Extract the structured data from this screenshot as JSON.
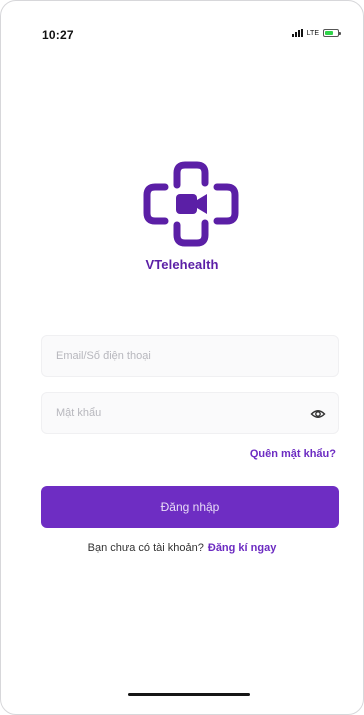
{
  "status_bar": {
    "time": "10:27",
    "network": "LTE",
    "battery_level": 0.7
  },
  "brand": {
    "name": "VTelehealth",
    "logo_icon": "medical-cross-video-camera-icon",
    "color": "#5b1fa6"
  },
  "login_form": {
    "email_placeholder": "Email/Số điện thoại",
    "email_value": "",
    "password_placeholder": "Mật khẩu",
    "password_value": "",
    "password_toggle_icon": "eye-icon",
    "forgot_password_label": "Quên mật khẩu?",
    "login_button_label": "Đăng nhập",
    "accent_color": "#6e2dc3"
  },
  "signup": {
    "prompt": "Bạn chưa có tài khoản?",
    "link_label": "Đăng kí ngay"
  }
}
